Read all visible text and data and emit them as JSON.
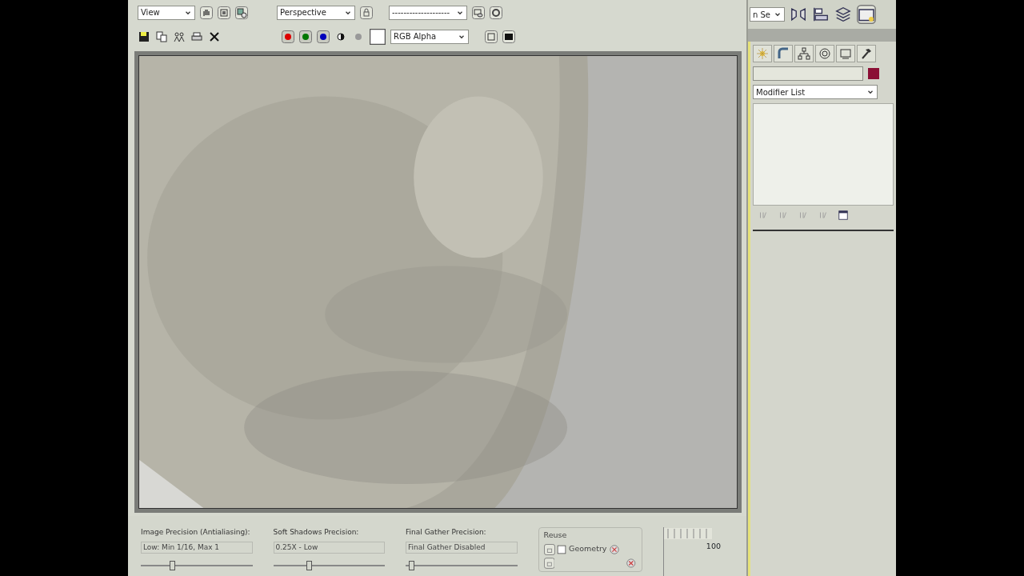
{
  "render_toolbar": {
    "area_dropdown": "View",
    "viewport_dropdown": "Perspective",
    "preset_dropdown": "--------------------",
    "channel_dropdown": "RGB Alpha"
  },
  "bottom_panel": {
    "precisions": [
      {
        "label": "Image Precision (Antialiasing):",
        "value": "Low: Min 1/16, Max 1",
        "level": 0.28
      },
      {
        "label": "Soft Shadows Precision:",
        "value": "0.25X - Low",
        "level": 0.32
      },
      {
        "label": "Final Gather Precision:",
        "value": "Final Gather Disabled",
        "level": 0.05
      }
    ],
    "reuse": {
      "title": "Reuse",
      "geometry": {
        "label": "Geometry",
        "checked": false
      }
    },
    "timeline_label": "100"
  },
  "command_panel": {
    "selection_dropdown": "n Se",
    "modifier_dropdown": "Modifier List"
  }
}
